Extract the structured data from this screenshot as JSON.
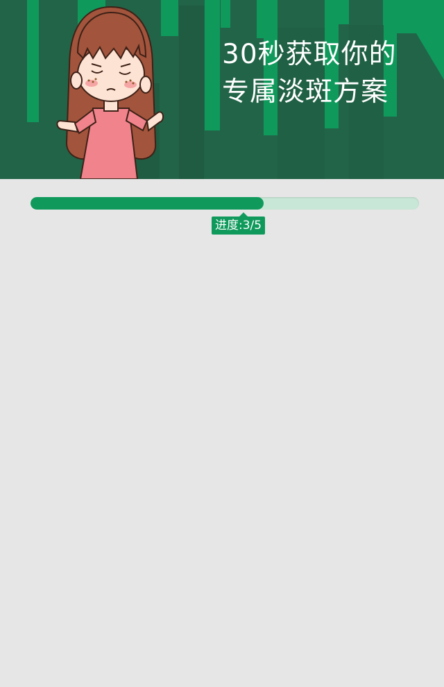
{
  "banner": {
    "title_line1": "30秒获取你的",
    "title_line2": "专属淡斑方案",
    "colors": {
      "dark_green": "#226448",
      "bright_green": "#0f9a5c"
    }
  },
  "progress": {
    "label": "进度:3/5",
    "current_step": 3,
    "total_steps": 5,
    "fill_fraction": 0.6,
    "track_color": "#c9e7d7",
    "fill_color": "#0f9a5c"
  }
}
